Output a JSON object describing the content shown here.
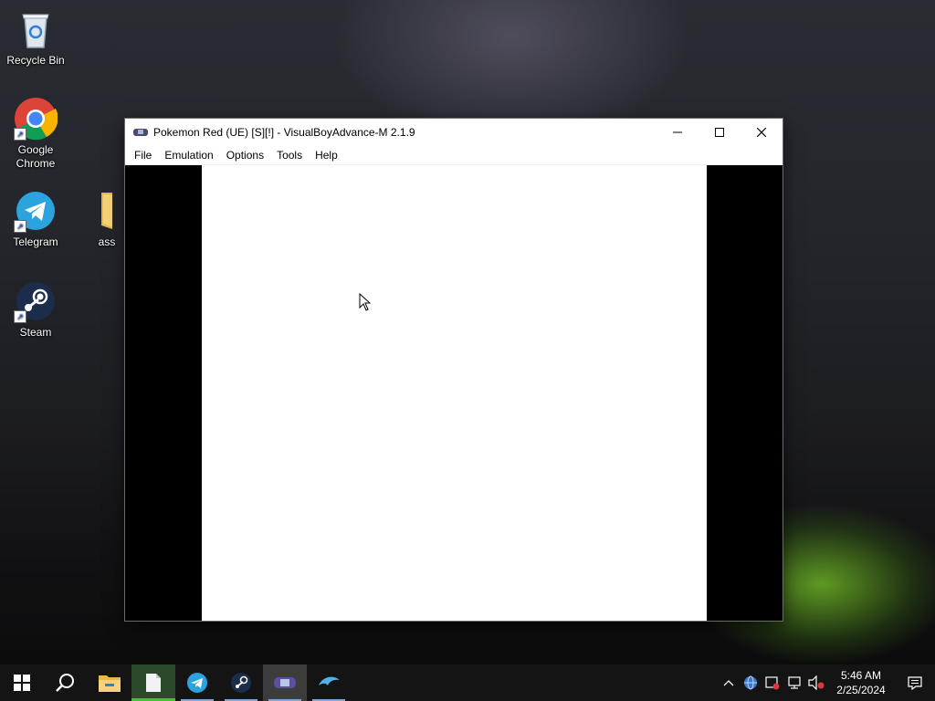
{
  "desktop": {
    "icons": [
      {
        "label": "Recycle Bin"
      },
      {
        "label": "Google Chrome"
      },
      {
        "label": "Telegram"
      },
      {
        "label": "ass"
      },
      {
        "label": "Steam"
      }
    ]
  },
  "window": {
    "title": "Pokemon Red (UE) [S][!] - VisualBoyAdvance-M 2.1.9",
    "menu": [
      "File",
      "Emulation",
      "Options",
      "Tools",
      "Help"
    ]
  },
  "taskbar": {
    "apps": [
      "start-icon",
      "search-icon",
      "file-explorer-icon",
      "notepad-icon",
      "telegram-icon",
      "steam-icon",
      "visualboyadvance-icon",
      "dolphin-icon"
    ]
  },
  "tray": {
    "time": "5:46 AM",
    "date": "2/25/2024"
  },
  "colors": {
    "taskbar": "#141414",
    "accent_blue": "#1a5bd6"
  }
}
